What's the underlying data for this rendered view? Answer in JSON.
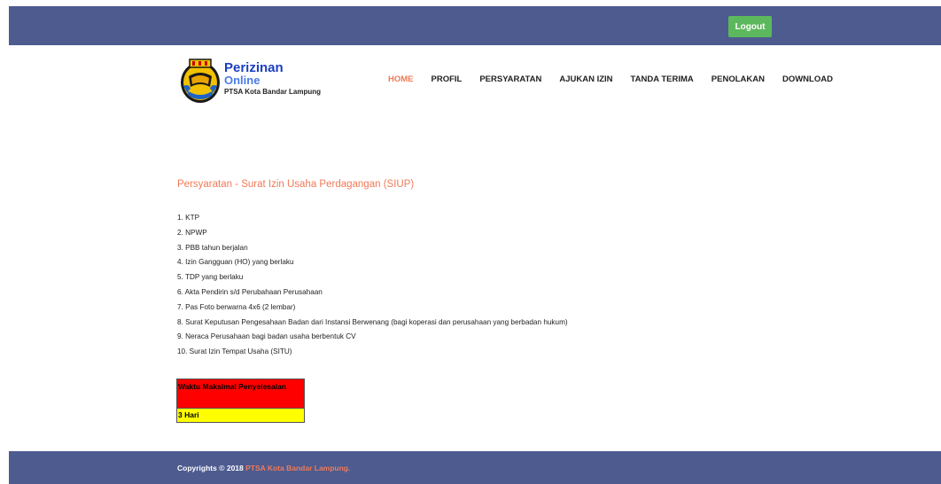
{
  "header": {
    "logout_label": "Logout"
  },
  "brand": {
    "title": "Perizinan",
    "subtitle": "Online",
    "org": "PTSA Kota Bandar Lampung",
    "logo_icon": "kota-bandar-lampung-emblem-icon"
  },
  "nav": {
    "items": [
      {
        "label": "HOME",
        "active": true
      },
      {
        "label": "PROFIL"
      },
      {
        "label": "PERSYARATAN"
      },
      {
        "label": "AJUKAN IZIN"
      },
      {
        "label": "TANDA TERIMA"
      },
      {
        "label": "PENOLAKAN"
      },
      {
        "label": "DOWNLOAD"
      }
    ]
  },
  "main": {
    "title": "Persyaratan - Surat Izin Usaha Perdagangan (SIUP)",
    "requirements": [
      "1. KTP",
      "2. NPWP",
      "3. PBB tahun berjalan",
      "4. Izin Gangguan (HO) yang berlaku",
      "5. TDP yang berlaku",
      "6. Akta Pendirin s/d Perubahaan Perusahaan",
      "7. Pas Foto berwarna 4x6 (2 lembar)",
      "8. Surat Keputusan Pengesahaan Badan dari Instansi Berwenang (bagi koperasi dan perusahaan yang berbadan hukum)",
      "9. Neraca Perusahaan bagi badan usaha berbentuk CV",
      "10. Surat Izin Tempat Usaha (SITU)"
    ],
    "time_box": {
      "label": "Waktu Maksimal Penyelesaian",
      "value": "3 Hari"
    }
  },
  "footer": {
    "copyright_prefix": "Copyrights © 2018",
    "copyright_org": "PTSA Kota Bandar Lampung."
  },
  "colors": {
    "header_bg": "#4d5b8f",
    "accent": "#f07a58",
    "logout_bg": "#5cb85c",
    "time_label_bg": "#ff0000",
    "time_value_bg": "#ffff00"
  }
}
